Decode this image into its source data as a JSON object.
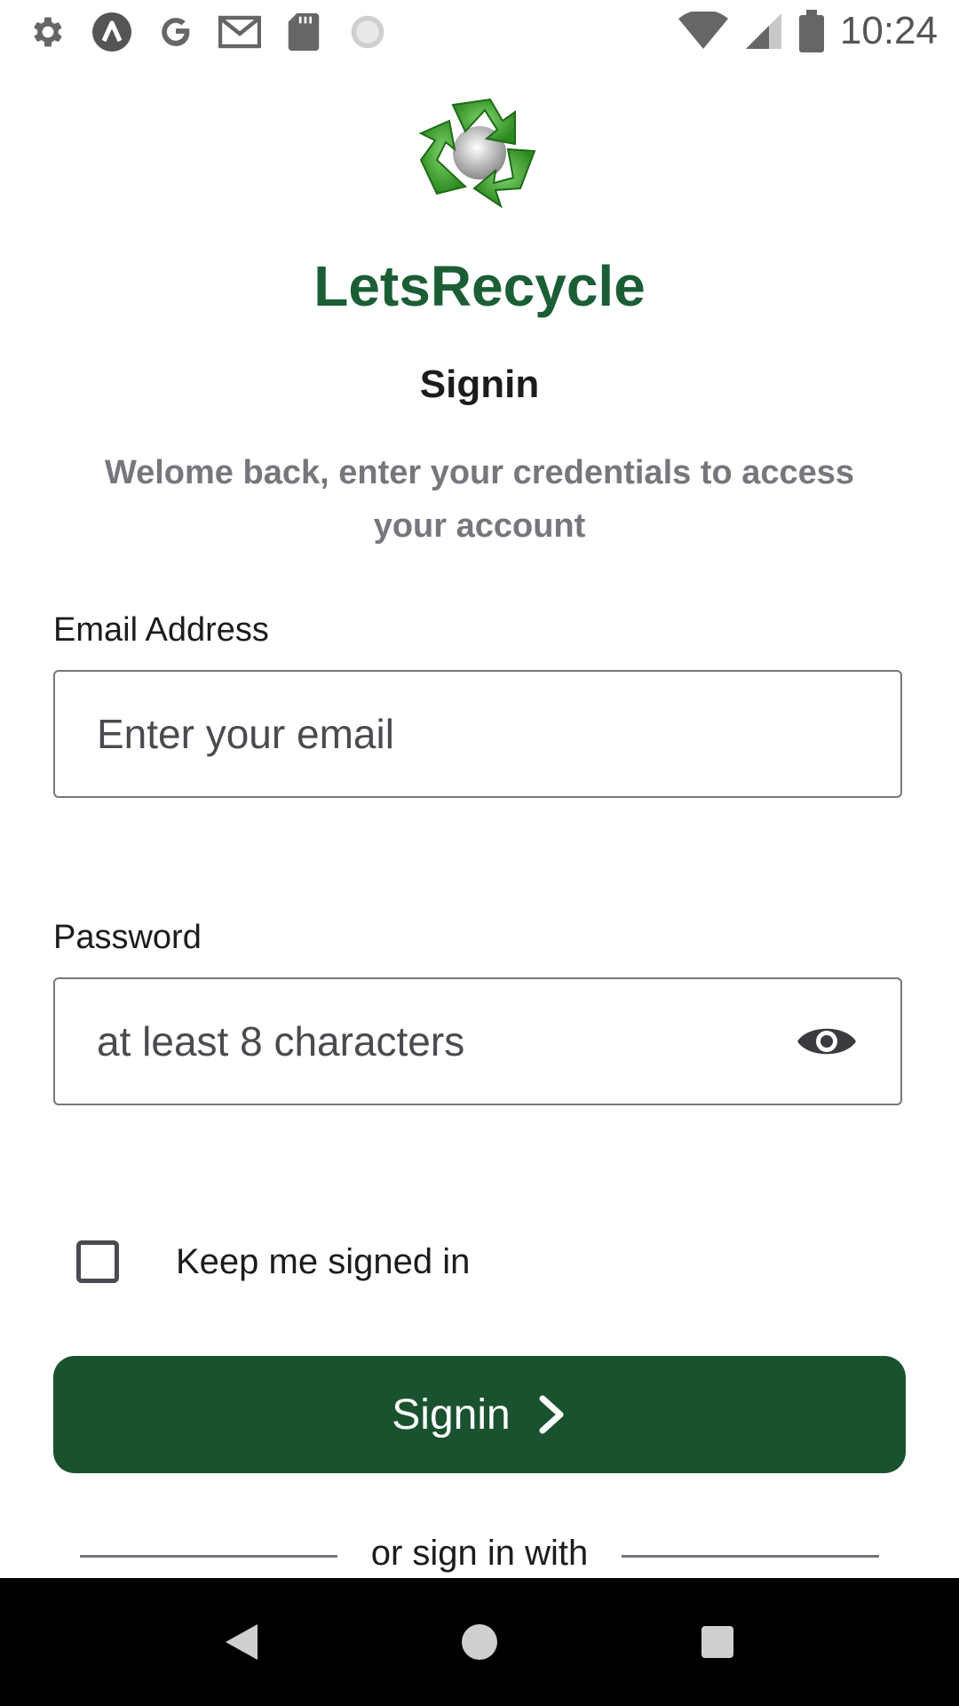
{
  "status_bar": {
    "time": "10:24",
    "left_icons": [
      "gear-icon",
      "launcher-a-icon",
      "google-g-icon",
      "gmail-icon",
      "sd-card-icon",
      "loading-spinner-icon"
    ],
    "right_icons": [
      "wifi-icon",
      "cell-signal-icon",
      "battery-icon"
    ]
  },
  "app": {
    "name": "LetsRecycle",
    "brand_color": "#1b5e35",
    "logo": "recycle-logo-icon"
  },
  "signin": {
    "title": "Signin",
    "subtitle": "Welome back, enter your credentials to access your account",
    "email_label": "Email Address",
    "email_placeholder": "Enter your email",
    "email_value": "",
    "password_label": "Password",
    "password_placeholder": "at least 8 characters",
    "password_value": "",
    "keep_signed_in_label": "Keep me signed in",
    "keep_signed_in_checked": false,
    "button_label": "Signin",
    "button_color": "#1a5230",
    "alt_signin_text": "or sign in with"
  },
  "nav_bar": {
    "buttons": [
      "back-icon",
      "home-icon",
      "recents-icon"
    ]
  }
}
